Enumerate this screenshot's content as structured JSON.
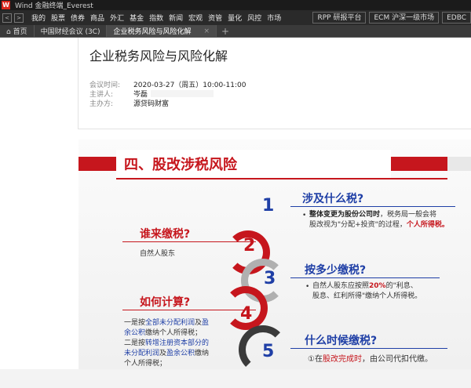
{
  "window": {
    "logo": "W",
    "title": "Wind 金融终端_Everest"
  },
  "menubar": {
    "back": "<",
    "forward": ">",
    "items": [
      "我的",
      "股票",
      "债券",
      "商品",
      "外汇",
      "基金",
      "指数",
      "新闻",
      "宏观",
      "资管",
      "量化",
      "风控",
      "市场"
    ],
    "right_buttons": [
      "RPP 研报平台",
      "ECM 沪深一级市场",
      "EDBC"
    ]
  },
  "tabs": [
    {
      "label": "⌂ 首页"
    },
    {
      "label": "中国财经会议 (3C)"
    },
    {
      "label": "企业税务风险与风险化解",
      "close": "×"
    }
  ],
  "tab_add": "+",
  "meeting": {
    "title": "企业税务风险与风险化解",
    "time_label": "会议时间:",
    "time_value": "2020-03-27（周五）10:00-11:00",
    "host_label": "主讲人:",
    "host_value": "岑磊",
    "organizer_label": "主办方:",
    "organizer_value": "源贷码财富"
  },
  "slide": {
    "title": "四、股改涉税风险",
    "numbers": [
      "1",
      "2",
      "3",
      "4",
      "5"
    ],
    "q1": {
      "title": "涉及什么税?",
      "bullet": "•",
      "line1_bold": "整体变更为股份公司时",
      "line1_rest": "，税务局一般会将",
      "line2": "股改视为\"分配+投资\"的过程，",
      "line2_red": "个人所得税。"
    },
    "q_left1": {
      "title": "谁来缴税?",
      "text": "自然人股东"
    },
    "q2": {
      "title": "按多少缴税?",
      "bullet": "•",
      "line1_a": "自然人股东应按照",
      "line1_red": "20%",
      "line1_b": "的\"利息、",
      "line2": "股息、红利所得\"缴纳个人所得税。"
    },
    "q_left2": {
      "title": "如何计算?",
      "l1a": "一是按",
      "l1b": "全部未分配利润",
      "l1c": "及",
      "l1d": "盈",
      "l2a": "余公积",
      "l2b": "缴纳个人所得税；",
      "l3a": "二是按",
      "l3b": "转增注册资本部分的",
      "l4a": "未分配利润",
      "l4b": "及",
      "l4c": "盈余公积",
      "l4d": "缴纳",
      "l5": "个人所得税；"
    },
    "q3": {
      "title": "什么时候缴税?",
      "prefix": "①在",
      "red": "股改完成时",
      "rest": "，由公司代扣代缴。"
    }
  },
  "colors": {
    "accent_red": "#c6161d",
    "accent_blue": "#1f3fa6",
    "ring_gray": "#b0b0b0",
    "ring_dark": "#3a3a3a"
  }
}
